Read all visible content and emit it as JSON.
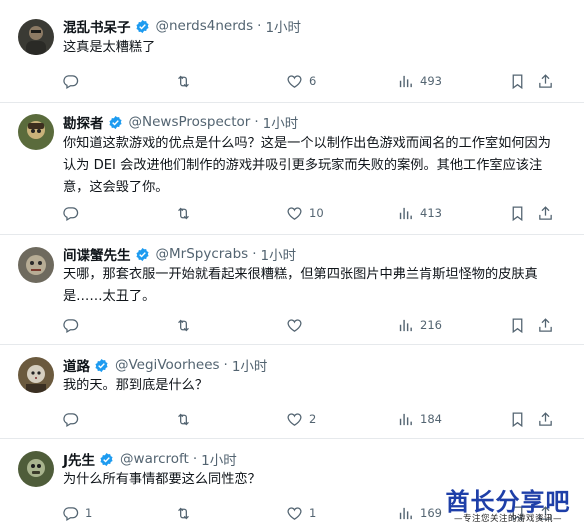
{
  "tweets": [
    {
      "name": "混乱书呆子",
      "handle": "@nerds4nerds",
      "time": "1小时",
      "text": "这真是太糟糕了",
      "replies": "",
      "retweets": "",
      "likes": "6",
      "views": "493",
      "avatar_color": "#3a3a34"
    },
    {
      "name": "勘探者",
      "handle": "@NewsProspector",
      "time": "1小时",
      "text": "你知道这款游戏的优点是什么吗？这是一个以制作出色游戏而闻名的工作室如何因为认为 DEI 会改进他们制作的游戏并吸引更多玩家而失败的案例。其他工作室应该注意，这会毁了你。",
      "replies": "",
      "retweets": "",
      "likes": "10",
      "views": "413",
      "avatar_color": "#5a6b3c"
    },
    {
      "name": "间谍蟹先生",
      "handle": "@MrSpycrabs",
      "time": "1小时",
      "text": "天哪，那套衣服一开始就看起来很糟糕，但第四张图片中弗兰肯斯坦怪物的皮肤真是……太丑了。",
      "replies": "",
      "retweets": "",
      "likes": "",
      "views": "216",
      "avatar_color": "#6e6a5e"
    },
    {
      "name": "道路",
      "handle": "@VegiVoorhees",
      "time": "1小时",
      "text": "我的天。那到底是什么？",
      "replies": "",
      "retweets": "",
      "likes": "2",
      "views": "184",
      "avatar_color": "#6b5a3e"
    },
    {
      "name": "J先生",
      "handle": "@warcroft",
      "time": "1小时",
      "text": "为什么所有事情都要这么同性恋？",
      "replies": "1",
      "retweets": "",
      "likes": "1",
      "views": "169",
      "avatar_color": "#4f5d3a"
    }
  ],
  "watermark": {
    "title": "酋长分享吧",
    "subtitle": "—专注您关注的游戏资讯—"
  },
  "colors": {
    "verified": "#1d9bf0",
    "muted": "#536471",
    "divider": "#e6e9ec",
    "watermark": "#1e3fa8"
  },
  "icons": [
    "reply-icon",
    "retweet-icon",
    "like-icon",
    "views-icon",
    "bookmark-icon",
    "share-icon",
    "verified-badge-icon"
  ]
}
